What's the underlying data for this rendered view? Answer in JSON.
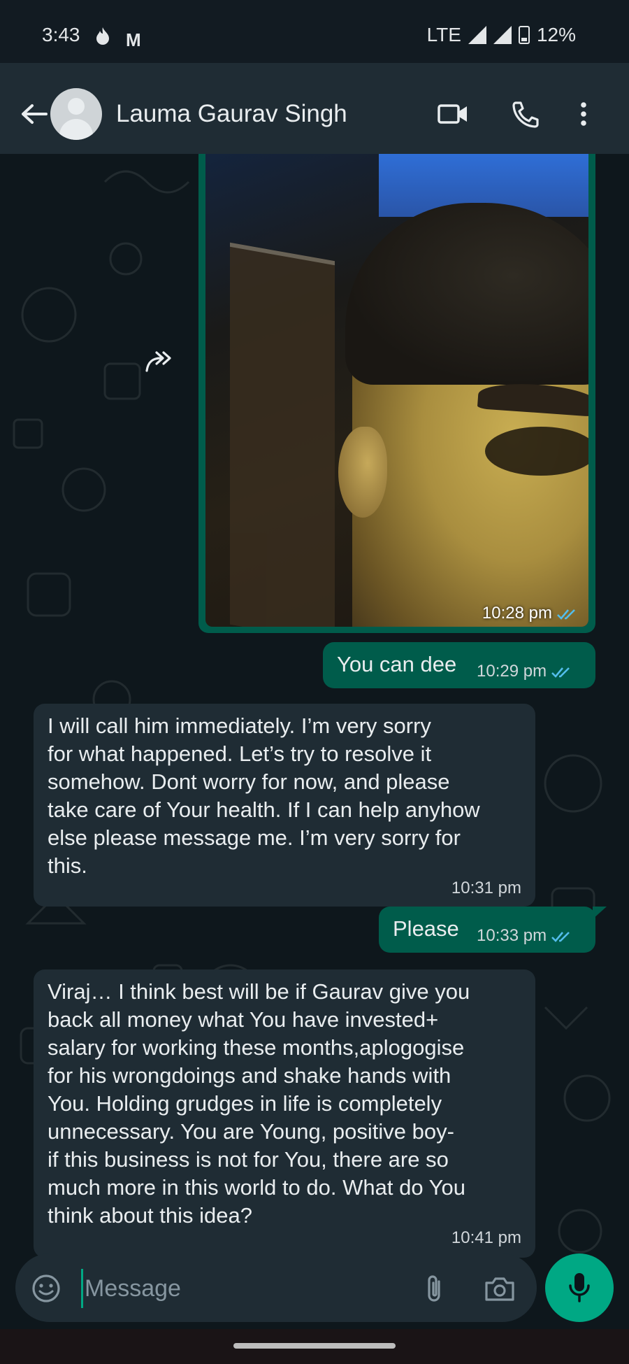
{
  "status_bar": {
    "time": "3:43",
    "notification_icons": [
      "flame-icon",
      "gmail-icon"
    ],
    "network": "LTE",
    "battery": "12%"
  },
  "header": {
    "contact_name": "Lauma Gaurav Singh",
    "icons": [
      "back-arrow-icon",
      "video-call-icon",
      "voice-call-icon",
      "more-options-icon"
    ]
  },
  "messages": [
    {
      "direction": "outgoing",
      "type": "image",
      "time": "10:28 pm",
      "status": "read"
    },
    {
      "direction": "outgoing",
      "type": "text",
      "text": "You can dee",
      "time": "10:29 pm",
      "status": "read"
    },
    {
      "direction": "incoming",
      "type": "text",
      "lines": [
        "I will call him immediately. I’m very sorry",
        "for what happened. Let’s try to resolve it",
        "somehow. Dont worry for now, and please",
        "take care of Your health. If I can help anyhow",
        "else please message me. I’m very sorry for",
        "this."
      ],
      "time": "10:31 pm"
    },
    {
      "direction": "outgoing",
      "type": "text",
      "text": "Please",
      "time": "10:33 pm",
      "status": "read"
    },
    {
      "direction": "incoming",
      "type": "text",
      "lines": [
        "Viraj… I think best will be if Gaurav give you",
        "back all money what You have invested+",
        "salary for working these months,aplogogise",
        "for his wrongdoings and shake hands with",
        "You. Holding grudges in life is completely",
        "unnecessary. You are Young, positive boy-",
        "if this business is not for You, there are so",
        "much more in this world to do. What do You",
        "think about this idea?"
      ],
      "time": "10:41 pm"
    }
  ],
  "composer": {
    "placeholder": "Message",
    "value": "",
    "icons": [
      "emoji-icon",
      "attach-icon",
      "camera-icon",
      "mic-icon"
    ]
  },
  "colors": {
    "outgoing_bubble": "#005c4b",
    "incoming_bubble": "#1f2c34",
    "accent": "#00a884",
    "read_ticks": "#53bdeb",
    "background": "#0b141a"
  }
}
